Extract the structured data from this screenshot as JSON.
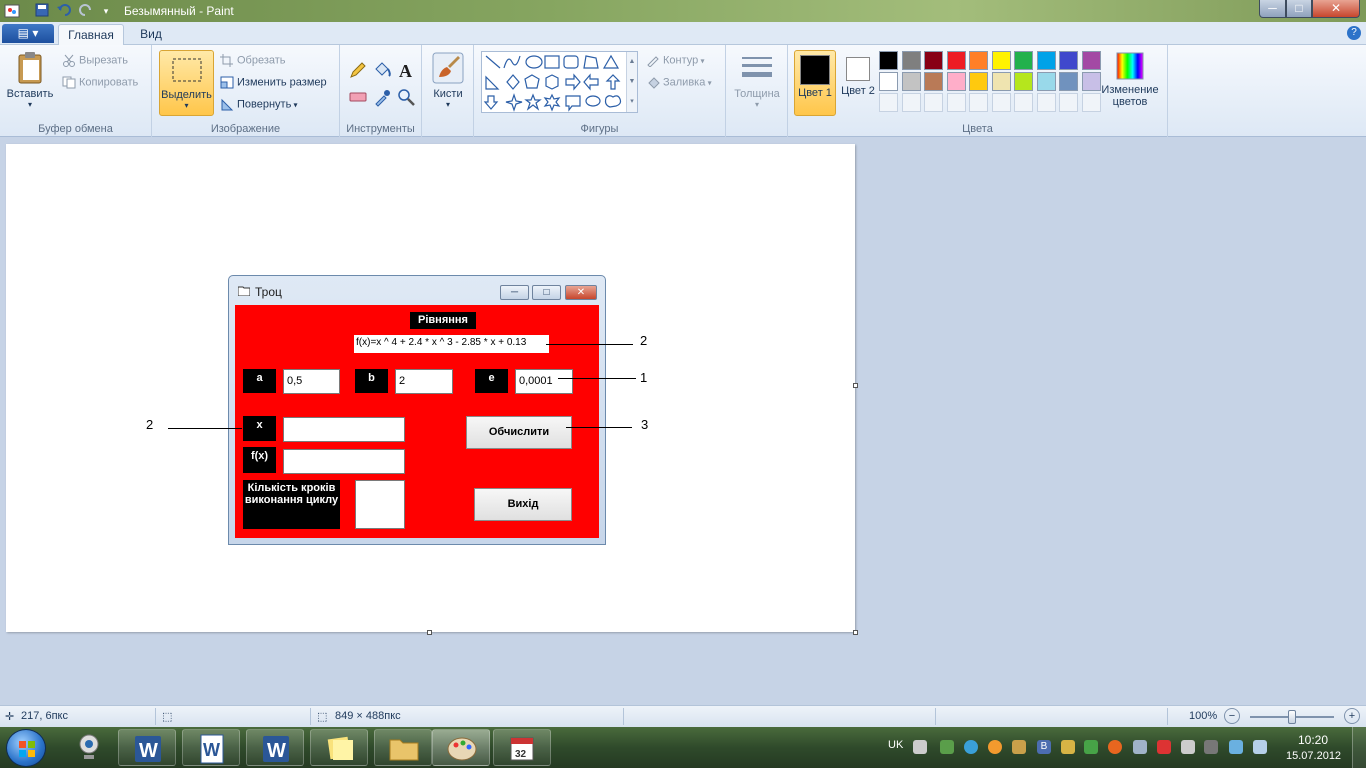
{
  "window": {
    "title": "Безымянный - Paint",
    "min": "─",
    "max": "□",
    "close": "✕"
  },
  "tabs": {
    "app_menu": "▤ ▾",
    "home": "Главная",
    "view": "Вид",
    "help": "?"
  },
  "ribbon": {
    "clipboard": {
      "label": "Буфер обмена",
      "paste": "Вставить",
      "cut": "Вырезать",
      "copy": "Копировать"
    },
    "image": {
      "label": "Изображение",
      "select": "Выделить",
      "crop": "Обрезать",
      "resize": "Изменить размер",
      "rotate": "Повернуть"
    },
    "tools": {
      "label": "Инструменты"
    },
    "brushes": {
      "label": "Кисти"
    },
    "shapes": {
      "label": "Фигуры",
      "outline": "Контур",
      "fill": "Заливка"
    },
    "size": {
      "label": "Толщина"
    },
    "colors": {
      "label": "Цвета",
      "color1": "Цвет 1",
      "color2": "Цвет 2",
      "edit": "Изменение цветов",
      "palette_row1": [
        "#000000",
        "#7f7f7f",
        "#880015",
        "#ed1c24",
        "#ff7f27",
        "#fff200",
        "#22b14c",
        "#00a2e8",
        "#3f48cc",
        "#a349a4"
      ],
      "palette_row2": [
        "#ffffff",
        "#c3c3c3",
        "#b97a57",
        "#ffaec9",
        "#ffc90e",
        "#efe4b0",
        "#b5e61d",
        "#99d9ea",
        "#7092be",
        "#c8bfe7"
      ]
    }
  },
  "dialog": {
    "title": "Троц",
    "equation_label": "Рівняння",
    "equation": "f(x)=x ^ 4 + 2.4 * x ^ 3 - 2.85 * x + 0.13",
    "a_label": "a",
    "a_value": "0,5",
    "b_label": "b",
    "b_value": "2",
    "e_label": "e",
    "e_value": "0,0001",
    "x_label": "x",
    "fx_label": "f(x)",
    "steps_label": "Кількість кроків виконання циклу",
    "calc_button": "Обчислити",
    "exit_button": "Вихід"
  },
  "callouts": {
    "c1": "1",
    "c2_right": "2",
    "c2_left": "2",
    "c3": "3"
  },
  "status": {
    "cursor": "217, 6пкс",
    "canvas_size": "849 × 488пкс",
    "zoom": "100%",
    "zoom_out": "−",
    "zoom_in": "+",
    "zoom_level": 1.0
  },
  "taskbar": {
    "lang": "UK",
    "time": "10:20",
    "date": "15.07.2012"
  }
}
